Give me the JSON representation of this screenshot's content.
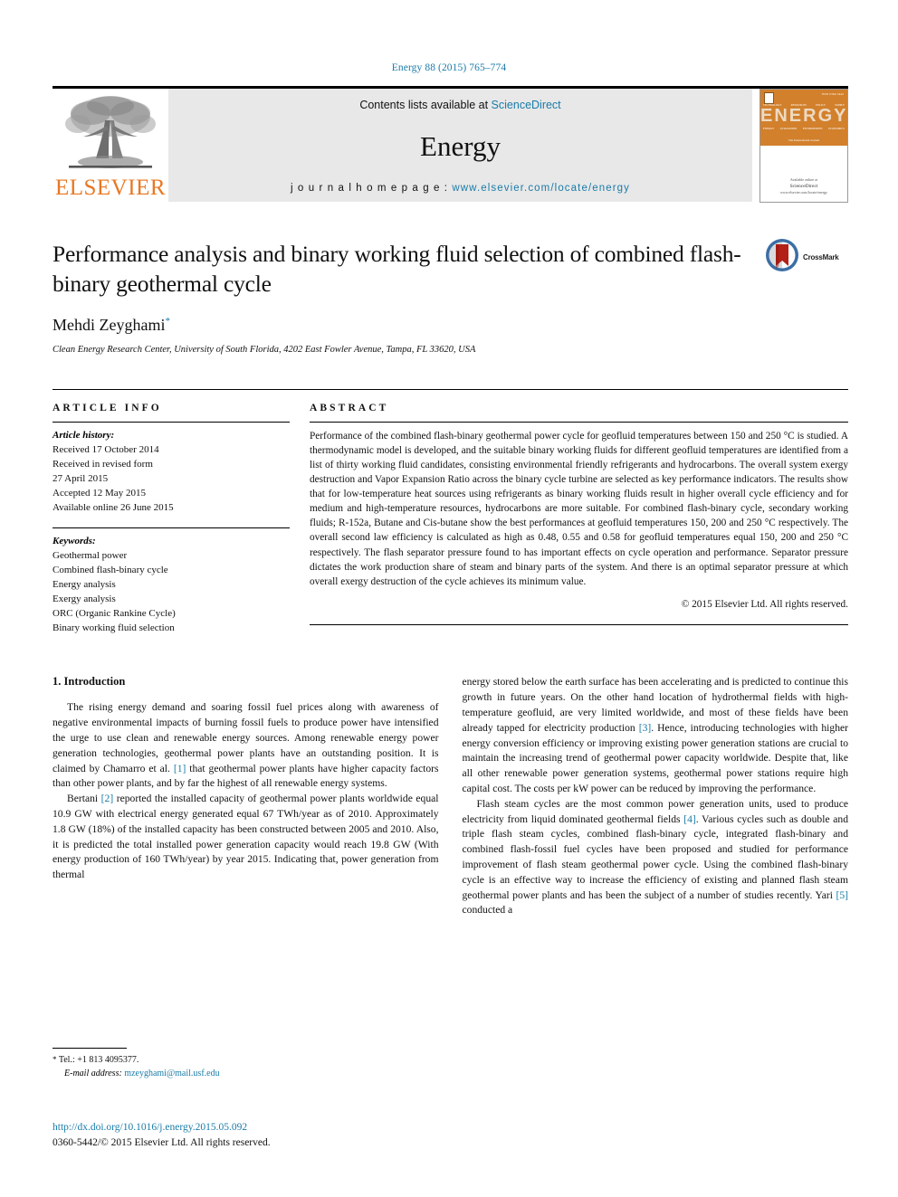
{
  "running_head": "Energy 88 (2015) 765–774",
  "masthead": {
    "publisher_logo_alt": "elsevier-tree-logo",
    "publisher_name": "ELSEVIER",
    "contents_prefix": "Contents lists available at ",
    "contents_link": "ScienceDirect",
    "journal_name": "Energy",
    "homepage_prefix": "j o u r n a l   h o m e p a g e :  ",
    "homepage_url": "www.elsevier.com/locate/energy",
    "cover": {
      "title": "ENERGY",
      "issue": "ISSN 0360-5442",
      "subtitle": "The International Journal",
      "words_top": [
        "TECHNOLOGY",
        "RESOURCES",
        "POLICY",
        "SUPPLY"
      ],
      "words_bottom": [
        "ENERGY",
        "UTILIZATION",
        "ENVIRONMENT",
        "ECONOMICS"
      ],
      "publisher_small": "Available online at",
      "publisher_big": "ScienceDirect",
      "publisher_url": "www.elsevier.com/locate/energy"
    }
  },
  "article": {
    "title": "Performance analysis and binary working fluid selection of combined flash-binary geothermal cycle",
    "author": "Mehdi Zeyghami",
    "author_marker": "*",
    "affiliation": "Clean Energy Research Center, University of South Florida, 4202 East Fowler Avenue, Tampa, FL 33620, USA",
    "crossmark_label": "CrossMark"
  },
  "article_info": {
    "heading": "ARTICLE INFO",
    "history_label": "Article history:",
    "history": [
      "Received 17 October 2014",
      "Received in revised form",
      "27 April 2015",
      "Accepted 12 May 2015",
      "Available online 26 June 2015"
    ],
    "keywords_label": "Keywords:",
    "keywords": [
      "Geothermal power",
      "Combined flash-binary cycle",
      "Energy analysis",
      "Exergy analysis",
      "ORC (Organic Rankine Cycle)",
      "Binary working fluid selection"
    ]
  },
  "abstract": {
    "heading": "ABSTRACT",
    "text": "Performance of the combined flash-binary geothermal power cycle for geofluid temperatures between 150 and 250 °C is studied. A thermodynamic model is developed, and the suitable binary working fluids for different geofluid temperatures are identified from a list of thirty working fluid candidates, consisting environmental friendly refrigerants and hydrocarbons. The overall system exergy destruction and Vapor Expansion Ratio across the binary cycle turbine are selected as key performance indicators. The results show that for low-temperature heat sources using refrigerants as binary working fluids result in higher overall cycle efficiency and for medium and high-temperature resources, hydrocarbons are more suitable. For combined flash-binary cycle, secondary working fluids; R-152a, Butane and Cis-butane show the best performances at geofluid temperatures 150, 200 and 250 °C respectively. The overall second law efficiency is calculated as high as 0.48, 0.55 and 0.58 for geofluid temperatures equal 150, 200 and 250 °C respectively. The flash separator pressure found to has important effects on cycle operation and performance. Separator pressure dictates the work production share of steam and binary parts of the system. And there is an optimal separator pressure at which overall exergy destruction of the cycle achieves its minimum value.",
    "copyright": "© 2015 Elsevier Ltd. All rights reserved."
  },
  "introduction": {
    "heading": "1.  Introduction",
    "left_paragraph_1_a": "The rising energy demand and soaring fossil fuel prices along with awareness of negative environmental impacts of burning fossil fuels to produce power have intensified the urge to use clean and renewable energy sources. Among renewable energy power generation technologies, geothermal power plants have an outstanding position. It is claimed by Chamarro et al. ",
    "left_paragraph_1_ref": "[1]",
    "left_paragraph_1_b": " that geothermal power plants have higher capacity factors than other power plants, and by far the highest of all renewable energy systems.",
    "left_paragraph_2_a": "Bertani ",
    "left_paragraph_2_ref": "[2]",
    "left_paragraph_2_b": " reported the installed capacity of geothermal power plants worldwide equal 10.9 GW with electrical energy generated equal 67 TWh/year as of 2010. Approximately 1.8 GW (18%) of the installed capacity has been constructed between 2005 and 2010. Also, it is predicted the total installed power generation capacity would reach 19.8 GW (With energy production of 160 TWh/year) by year 2015. Indicating that, power generation from thermal",
    "right_paragraph_1_a": "energy stored below the earth surface has been accelerating and is predicted to continue this growth in future years. On the other hand location of hydrothermal fields with high-temperature geofluid, are very limited worldwide, and most of these fields have been already tapped for electricity production ",
    "right_paragraph_1_ref": "[3]",
    "right_paragraph_1_b": ". Hence, introducing technologies with higher energy conversion efficiency or improving existing power generation stations are crucial to maintain the increasing trend of geothermal power capacity worldwide. Despite that, like all other renewable power generation systems, geothermal power stations require high capital cost. The costs per kW power can be reduced by improving the performance.",
    "right_paragraph_2_a": "Flash steam cycles are the most common power generation units, used to produce electricity from liquid dominated geothermal fields ",
    "right_paragraph_2_ref": "[4]",
    "right_paragraph_2_b": ". Various cycles such as double and triple flash steam cycles, combined flash-binary cycle, integrated flash-binary and combined flash-fossil fuel cycles have been proposed and studied for performance improvement of flash steam geothermal power cycle. Using the combined flash-binary cycle is an effective way to increase the efficiency of existing and planned flash steam geothermal power plants and has been the subject of a number of studies recently. Yari ",
    "right_paragraph_2_ref2": "[5]",
    "right_paragraph_2_c": " conducted a"
  },
  "footer": {
    "tel_marker": "*",
    "tel": "Tel.: +1 813 4095377.",
    "email_label": "E-mail address:",
    "email": "mzeyghami@mail.usf.edu",
    "doi": "http://dx.doi.org/10.1016/j.energy.2015.05.092",
    "issn_line": "0360-5442/© 2015 Elsevier Ltd. All rights reserved."
  },
  "colors": {
    "link": "#1a7ba8",
    "elsevier_orange": "#E87722",
    "banner_gray": "#e8e8e8",
    "cover_orange": "#d2802c",
    "crossmark_red": "#b32017",
    "crossmark_blue": "#3b6ea5"
  }
}
